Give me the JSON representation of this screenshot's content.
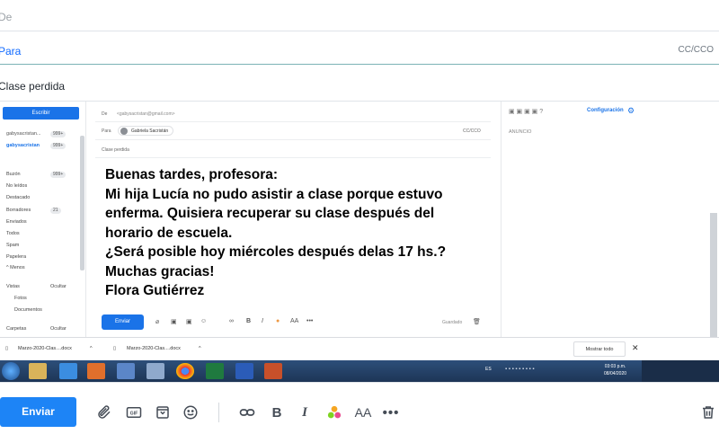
{
  "compose": {
    "from_label": "De",
    "to_label": "Para",
    "cc_label": "CC/CCO",
    "subject": "Clase perdida"
  },
  "embedded": {
    "left_rail": {
      "compose_label": "Escribir",
      "account_name": "gabysacristan...",
      "account_badge": "999+",
      "account_name_2": "gabysacristan",
      "account_badge_2": "999+",
      "folders": [
        "Buzón",
        "No leídos",
        "Destacado",
        "Borradores",
        "Enviados",
        "Todos",
        "Spam",
        "Papelera"
      ],
      "inbox_badge": "999+",
      "drafts_badge": "21",
      "less_label": "^ Menos",
      "views_label": "Vistas",
      "hide_label": "Ocultar",
      "photos_label": "Fotos",
      "documents_label": "Documentos",
      "folders_label": "Carpetas",
      "hide_label_2": "Ocultar"
    },
    "message": {
      "from_label": "De",
      "from_value": "<gabysacristan@gmail.com>",
      "to_label": "Para",
      "to_chip": "Gabriela Sacristán",
      "cc_label": "CC/CCO",
      "subject": "Clase perdida",
      "body_lines": [
        "Buenas tardes, profesora:",
        "Mi hija Lucía no pudo asistir a clase porque estuvo",
        "enferma. Quisiera recuperar su clase después del",
        "horario de escuela.",
        "¿Será posible hoy miércoles después delas 17 hs.?",
        "Muchas gracias!",
        "Flora Gutiérrez"
      ],
      "send_label": "Enviar",
      "saved_label": "Guardado"
    },
    "right_pane": {
      "config_label": "Configuración",
      "ad_label": "ANUNCIO"
    },
    "downloads": {
      "file1": "Marzo-2020-Clas....docx",
      "file2": "Marzo-2020-Clas....docx",
      "show_all": "Mostrar todo",
      "close": "✕"
    },
    "taskbar": {
      "lang": "ES",
      "time": "03:03 p.m.",
      "date": "08/04/2020"
    }
  },
  "toolbar": {
    "send_label": "Enviar",
    "gif_label": "GIF",
    "more_label": "•••"
  },
  "colors": {
    "accent": "#1d84f6",
    "link": "#0f69ff"
  }
}
